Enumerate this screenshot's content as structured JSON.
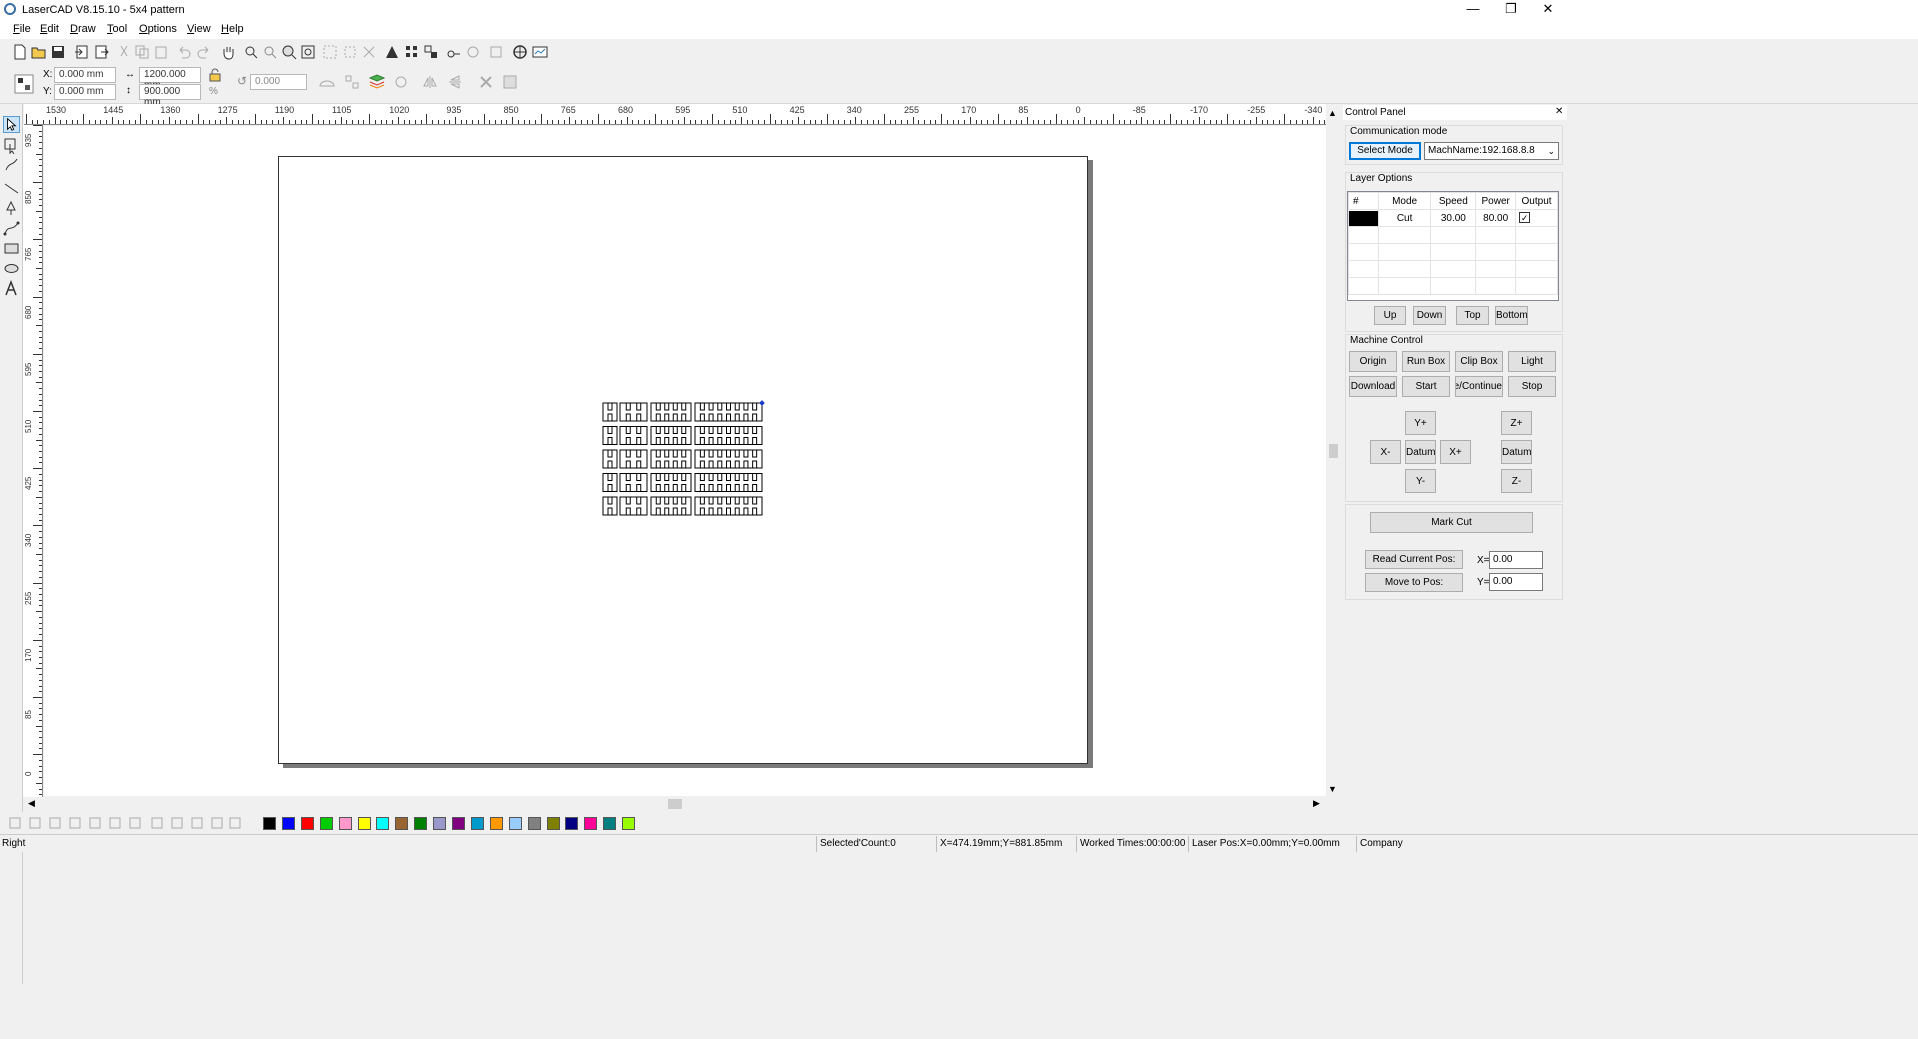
{
  "window": {
    "title": "LaserCAD V8.15.10 - 5x4 pattern",
    "minimize": "—",
    "maximize": "❐",
    "close": "✕"
  },
  "menu": [
    "File",
    "Edit",
    "Draw",
    "Tool",
    "Options",
    "View",
    "Help"
  ],
  "toolbar2": {
    "x_label": "X:",
    "x_value": "0.000 mm",
    "y_label": "Y:",
    "y_value": "0.000 mm",
    "width_value": "1200.000 mm",
    "height_value": "900.000 mm",
    "percent": "%",
    "rotate_value": "0.000"
  },
  "ruler": {
    "h_labels": [
      "1530",
      "1445",
      "1360",
      "1275",
      "1190",
      "1105",
      "1020",
      "935",
      "850",
      "765",
      "680",
      "595",
      "510",
      "425",
      "340",
      "255",
      "170",
      "85",
      "0",
      "-85",
      "-170",
      "-255",
      "-340"
    ],
    "v_labels": [
      "935",
      "850",
      "765",
      "680",
      "595",
      "510",
      "425",
      "340",
      "255",
      "170",
      "85",
      "0"
    ]
  },
  "palette": [
    "#000000",
    "#0000ff",
    "#ff0000",
    "#00cc00",
    "#ff99cc",
    "#ffff00",
    "#00ffff",
    "#996633",
    "#008000",
    "#9999cc",
    "#800080",
    "#0099cc",
    "#ff9900",
    "#99ccff",
    "#808080",
    "#808000",
    "#000080",
    "#ff0099",
    "#008080",
    "#99ff00"
  ],
  "status": {
    "mode": "Right",
    "selected": "Selected'Count:0",
    "coords": "X=474.19mm;Y=881.85mm",
    "worked": "Worked Times:00:00:00",
    "laser_pos": "Laser Pos:X=0.00mm;Y=0.00mm",
    "company": "Company"
  },
  "control_panel": {
    "title": "Control Panel",
    "close": "✕",
    "comm": {
      "label": "Communication mode",
      "select_mode": "Select Mode",
      "machine": "MachName:192.168.8.8"
    },
    "layers": {
      "label": "Layer Options",
      "headers": [
        "#",
        "Mode",
        "Speed",
        "Power",
        "Output"
      ],
      "rows": [
        {
          "color": "#000000",
          "mode": "Cut",
          "speed": "30.00",
          "power": "80.00",
          "output": "✓"
        }
      ],
      "buttons": [
        "Up",
        "Down",
        "Top",
        "Bottom"
      ]
    },
    "machine": {
      "label": "Machine Control",
      "row1": [
        "Origin",
        "Run Box",
        "Clip Box",
        "Light"
      ],
      "row2": [
        "Download",
        "Start",
        "Pause/Continue",
        "Stop"
      ],
      "jog": {
        "yplus": "Y+",
        "xminus": "X-",
        "datum": "Datum",
        "xplus": "X+",
        "yminus": "Y-",
        "zplus": "Z+",
        "zdatum": "Datum",
        "zminus": "Z-"
      },
      "mark_cut": "Mark Cut",
      "read_pos": "Read Current Pos:",
      "move_pos": "Move to Pos:",
      "x_label": "X=",
      "x_value": "0.00",
      "y_label": "Y=",
      "y_value": "0.00"
    }
  }
}
